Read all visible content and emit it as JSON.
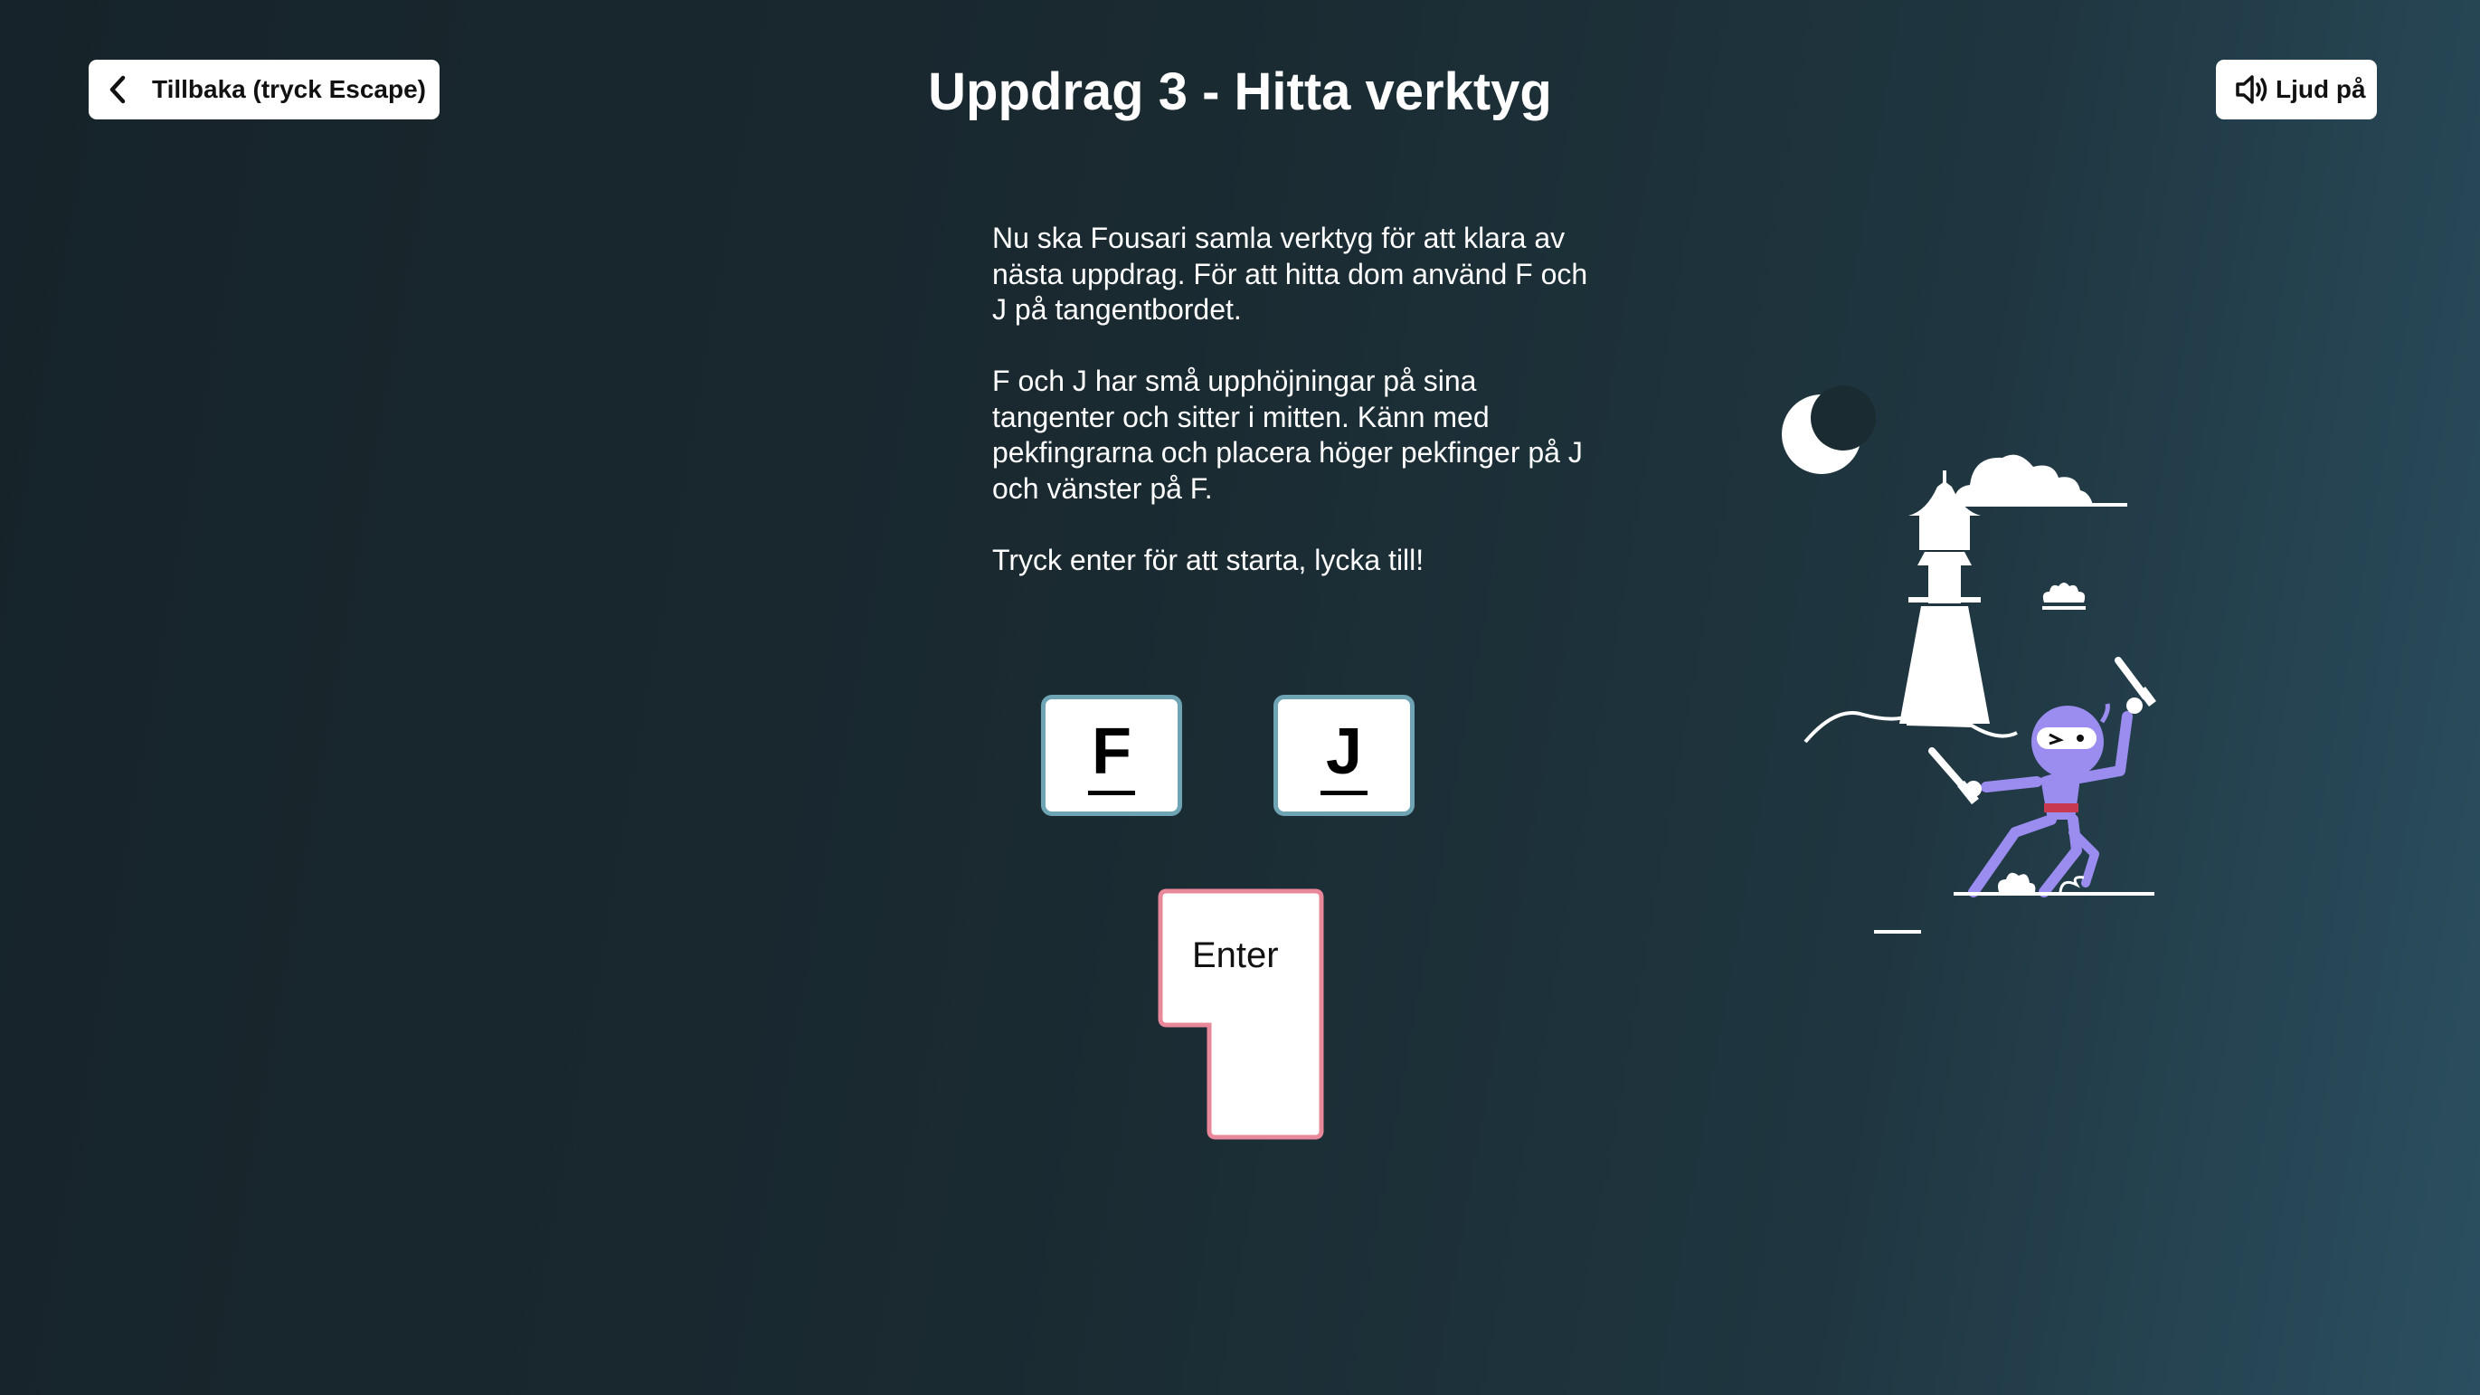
{
  "header": {
    "back_label": "Tillbaka (tryck Escape)",
    "title": "Uppdrag 3 - Hitta verktyg",
    "sound_label": "Ljud på"
  },
  "instructions": {
    "paragraph1": "Nu ska Fousari samla verktyg för att klara av nästa uppdrag. För att hitta dom använd F och J på tangentbordet.",
    "paragraph2": "F och J har små upphöjningar på sina tangenter och sitter i mitten. Känn med pekfingrarna och placera höger pekfinger på J och vänster på F.",
    "paragraph3": "Tryck enter för att starta, lycka till!"
  },
  "keys": {
    "f": "F",
    "j": "J",
    "enter": "Enter"
  },
  "icons": {
    "back": "chevron-left-icon",
    "sound": "speaker-icon"
  },
  "colors": {
    "key_border": "#6fa4b4",
    "enter_border": "#e9889a",
    "ninja": "#9b8cf0",
    "ninja_belt": "#c8384f"
  }
}
